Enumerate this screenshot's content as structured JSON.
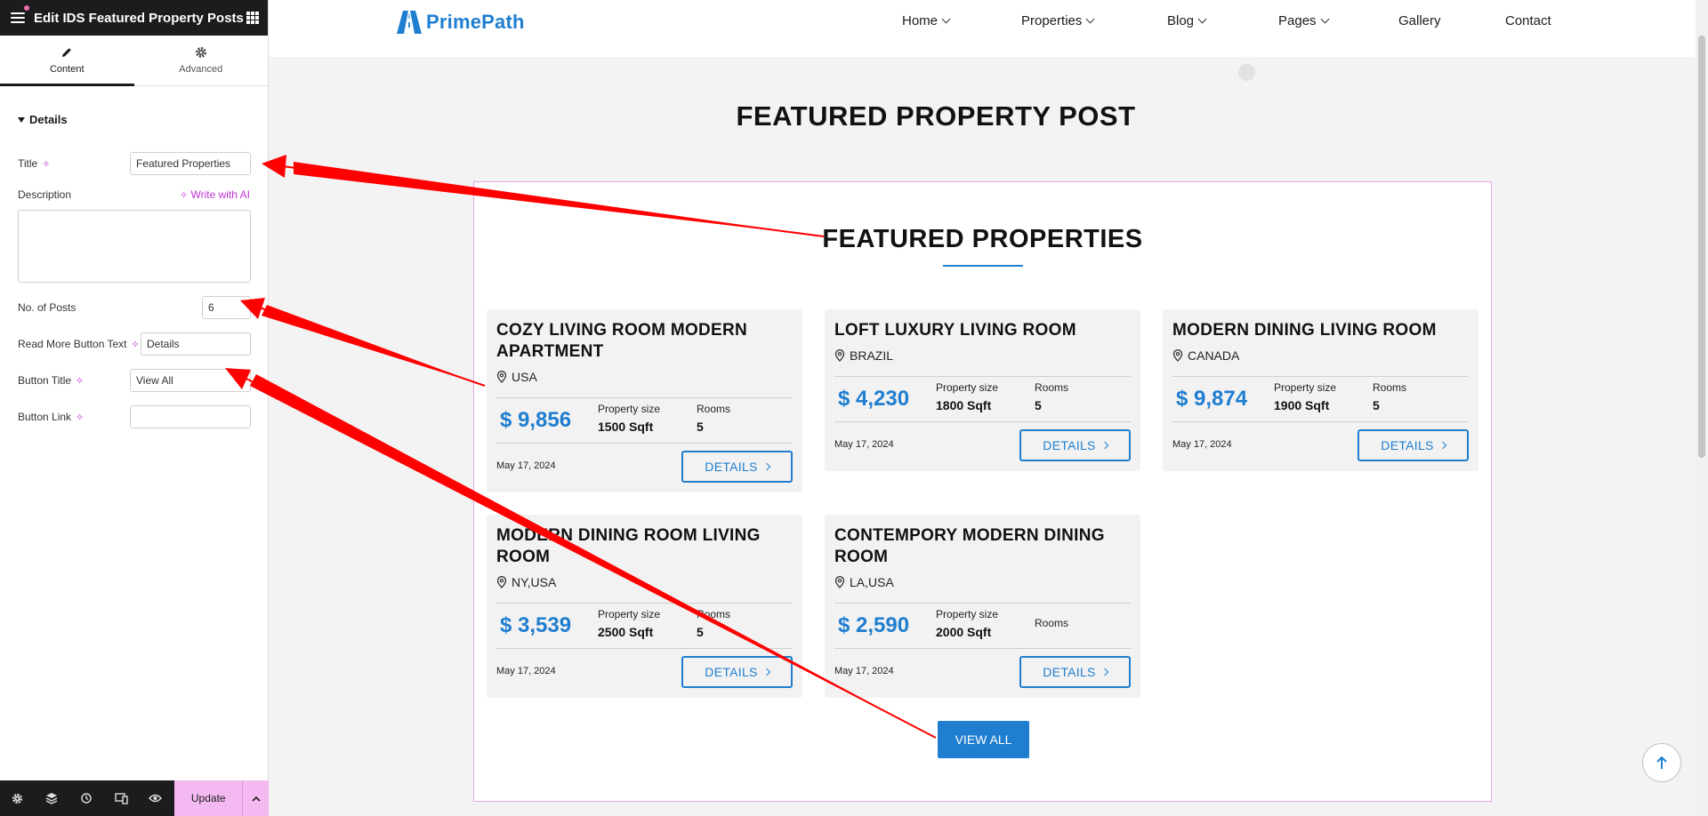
{
  "panel": {
    "title": "Edit IDS Featured Property Posts",
    "tabs": [
      {
        "label": "Content",
        "icon": "pencil-icon",
        "active": true
      },
      {
        "label": "Advanced",
        "icon": "gear-icon",
        "active": false
      }
    ],
    "section": "Details",
    "fields": {
      "title_label": "Title",
      "title_value": "Featured Properties",
      "description_label": "Description",
      "write_ai": "Write with AI",
      "posts_label": "No. of Posts",
      "posts_value": "6",
      "readmore_label": "Read More Button Text",
      "readmore_value": "Details",
      "button_title_label": "Button Title",
      "button_title_value": "View All",
      "button_link_label": "Button Link",
      "button_link_value": ""
    },
    "footer": {
      "update_label": "Update"
    }
  },
  "site": {
    "logo": "PrimePath",
    "nav": [
      {
        "label": "Home",
        "dropdown": true
      },
      {
        "label": "Properties",
        "dropdown": true
      },
      {
        "label": "Blog",
        "dropdown": true
      },
      {
        "label": "Pages",
        "dropdown": true
      },
      {
        "label": "Gallery",
        "dropdown": false
      },
      {
        "label": "Contact",
        "dropdown": false
      }
    ],
    "page_heading": "FEATURED PROPERTY POST",
    "section_title": "FEATURED PROPERTIES",
    "size_label": "Property size",
    "rooms_label": "Rooms",
    "details_label": "DETAILS",
    "cards": [
      {
        "title": "COZY LIVING ROOM MODERN APARTMENT",
        "location": "USA",
        "price": "$ 9,856",
        "size": "1500 Sqft",
        "rooms": "5",
        "date": "May 17, 2024"
      },
      {
        "title": "LOFT LUXURY LIVING ROOM",
        "location": "BRAZIL",
        "price": "$ 4,230",
        "size": "1800 Sqft",
        "rooms": "5",
        "date": "May 17, 2024"
      },
      {
        "title": "MODERN DINING LIVING ROOM",
        "location": "CANADA",
        "price": "$ 9,874",
        "size": "1900 Sqft",
        "rooms": "5",
        "date": "May 17, 2024"
      },
      {
        "title": "MODERN DINING ROOM LIVING ROOM",
        "location": "NY,USA",
        "price": "$ 3,539",
        "size": "2500 Sqft",
        "rooms": "5",
        "date": "May 17, 2024"
      },
      {
        "title": "CONTEMPORY MODERN DINING ROOM",
        "location": "LA,USA",
        "price": "$ 2,590",
        "size": "2000 Sqft",
        "rooms": "",
        "date": "May 17, 2024"
      }
    ],
    "view_all": "VIEW ALL"
  },
  "colors": {
    "accent": "#1f7ed0",
    "editor_dark": "#1c1c1c",
    "update_button": "#f5b9f2",
    "ai_magenta": "#c034d4",
    "annotation_arrow": "#ff0000"
  }
}
